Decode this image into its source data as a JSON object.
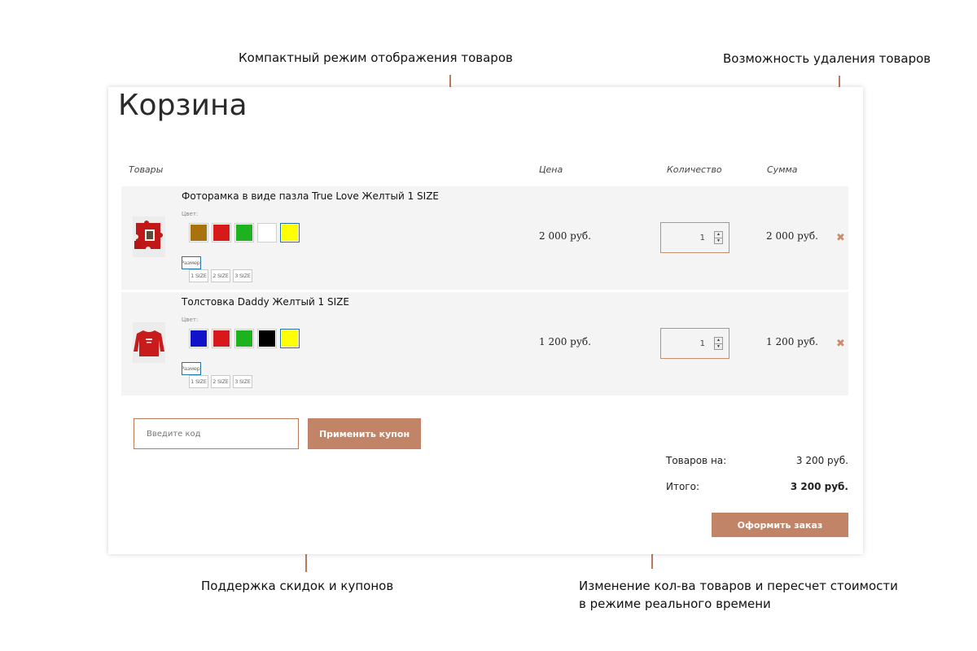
{
  "annotations": {
    "compact_mode": "Компактный режим отображения товаров",
    "delete_items": "Возможность удаления товаров",
    "coupons": "Поддержка скидок и купонов",
    "recalc_line1": "Изменение кол-ва товаров и пересчет стоимости",
    "recalc_line2": "в режиме реального времени"
  },
  "cart": {
    "title": "Корзина",
    "columns": {
      "items": "Товары",
      "price": "Цена",
      "quantity": "Количество",
      "sum": "Сумма"
    },
    "color_label": "Цвет:",
    "size_label": "Размер:",
    "remove_glyph": "✖",
    "items": [
      {
        "name": "Фоторамка в виде пазла True Love Желтый 1 SIZE",
        "price": "2 000 руб.",
        "quantity": "1",
        "sum": "2 000 руб.",
        "colors": [
          "#a8730f",
          "#d61a1a",
          "#1fb21f",
          "#ffffff",
          "#ffff00"
        ],
        "selected_color_index": 4,
        "sizes": [
          "1 SIZE",
          "2 SIZE",
          "3 SIZE"
        ],
        "selected_size_index": 0
      },
      {
        "name": "Толстовка Daddy Желтый 1 SIZE",
        "price": "1 200 руб.",
        "quantity": "1",
        "sum": "1 200 руб.",
        "colors": [
          "#1212c8",
          "#d61a1a",
          "#1fb21f",
          "#000000",
          "#ffff00"
        ],
        "selected_color_index": 4,
        "sizes": [
          "1 SIZE",
          "2 SIZE",
          "3 SIZE"
        ],
        "selected_size_index": 0
      }
    ],
    "coupon": {
      "placeholder": "Введите код",
      "button": "Применить купон"
    },
    "totals": {
      "subtotal_label": "Товаров на:",
      "subtotal_value": "3 200 руб.",
      "total_label": "Итого:",
      "total_value": "3 200 руб."
    },
    "checkout_button": "Оформить заказ"
  },
  "colors": {
    "accent": "#c18467",
    "line": "#b87a5a",
    "selected_border": "#1f73a8",
    "row_bg": "#f4f4f4"
  }
}
